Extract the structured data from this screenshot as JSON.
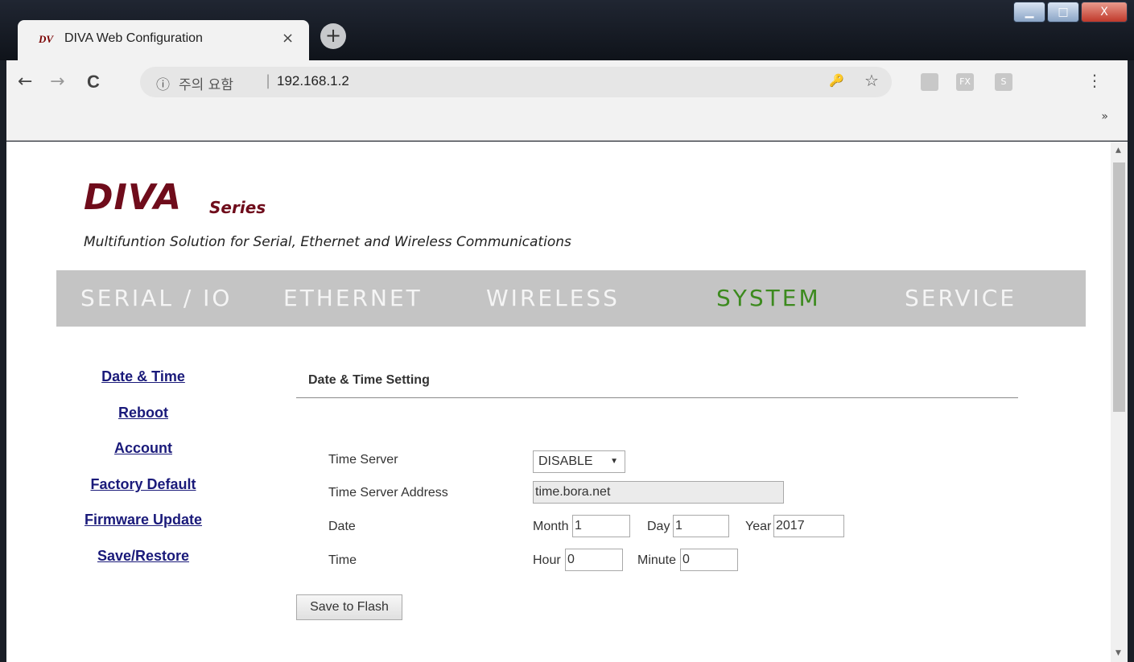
{
  "browser": {
    "tab": {
      "favicon": "DV",
      "title": "DIVA Web Configuration",
      "close": "×"
    },
    "new_tab": "+",
    "window_buttons": {
      "minimize": "▁",
      "maximize": "□",
      "close": "X"
    },
    "omnibox": {
      "info_icon": "ⓘ",
      "warning": "주의 요함",
      "separator": "|",
      "url": "192.168.1.2"
    },
    "nav": {
      "back": "←",
      "forward": "→",
      "reload": "C"
    },
    "toolbar_icons": {
      "key": "🔑",
      "star": "☆",
      "menu": "⋮"
    },
    "extensions": [
      "",
      "FX",
      "S"
    ],
    "overflow": "»"
  },
  "header": {
    "brand": "DIVA",
    "brand_sub": "Series",
    "tagline": "Multifuntion Solution for Serial, Ethernet and Wireless Communications"
  },
  "menu": [
    {
      "label": "SERIAL / IO",
      "active": false
    },
    {
      "label": "ETHERNET",
      "active": false
    },
    {
      "label": "WIRELESS",
      "active": false
    },
    {
      "label": "SYSTEM",
      "active": true
    },
    {
      "label": "SERVICE",
      "active": false
    }
  ],
  "sidebar": [
    "Date & Time",
    "Reboot",
    "Account",
    "Factory Default",
    "Firmware Update",
    "Save/Restore"
  ],
  "section": {
    "title": "Date & Time Setting"
  },
  "form": {
    "time_server": {
      "label": "Time Server",
      "value": "DISABLE",
      "arrow": "▼"
    },
    "time_server_address": {
      "label": "Time Server Address",
      "value": "time.bora.net"
    },
    "date": {
      "label": "Date",
      "month_label": "Month",
      "month": "1",
      "day_label": "Day",
      "day": "1",
      "year_label": "Year",
      "year": "2017"
    },
    "time": {
      "label": "Time",
      "hour_label": "Hour",
      "hour": "0",
      "minute_label": "Minute",
      "minute": "0"
    }
  },
  "save_button": "Save to Flash",
  "scrollbar": {
    "up": "▲",
    "down": "▼"
  }
}
